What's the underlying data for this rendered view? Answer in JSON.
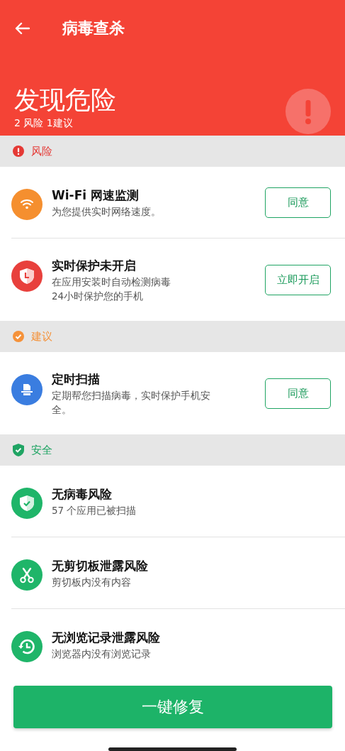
{
  "app_bar": {
    "title": "病毒查杀"
  },
  "summary": {
    "headline": "发现危险",
    "counts": "2 风险 1建议"
  },
  "sections": [
    {
      "kind": "risk",
      "label": "风险",
      "color": "#e53935",
      "items": [
        {
          "kind": "wifi",
          "title": "Wi-Fi 网速监测",
          "lines": [
            "为您提供实时网络速度。"
          ],
          "action": "同意"
        },
        {
          "kind": "protection",
          "title": "实时保护未开启",
          "lines": [
            "在应用安装时自动检测病毒",
            "24小时保护您的手机"
          ],
          "action": "立即开启"
        }
      ]
    },
    {
      "kind": "advice",
      "label": "建议",
      "color": "#f5923a",
      "items": [
        {
          "kind": "scan",
          "title": "定时扫描",
          "lines": [
            "定期帮您扫描病毒，实时保护手机安全。"
          ],
          "action": "同意"
        }
      ]
    },
    {
      "kind": "safe",
      "label": "安全",
      "color": "#1fa463",
      "items": [
        {
          "kind": "virus",
          "title": "无病毒风险",
          "lines": [
            "57 个应用已被扫描"
          ]
        },
        {
          "kind": "clipboard",
          "title": "无剪切板泄露风险",
          "lines": [
            "剪切板内没有内容"
          ]
        },
        {
          "kind": "browsing",
          "title": "无浏览记录泄露风险",
          "lines": [
            "浏览器内没有浏览记录"
          ]
        }
      ]
    }
  ],
  "fix_button": "一键修复"
}
